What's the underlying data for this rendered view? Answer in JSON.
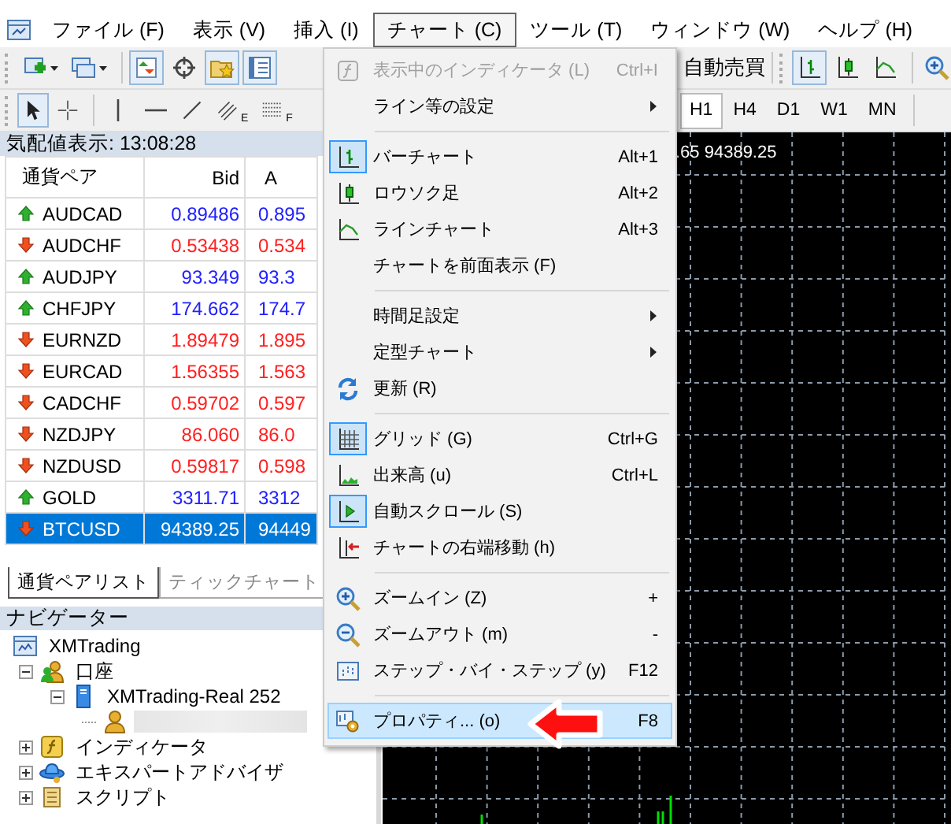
{
  "menu_bar": {
    "items": [
      {
        "label": "ファイル (F)",
        "selected": false
      },
      {
        "label": "表示 (V)",
        "selected": false
      },
      {
        "label": "挿入 (I)",
        "selected": false
      },
      {
        "label": "チャート (C)",
        "selected": true
      },
      {
        "label": "ツール (T)",
        "selected": false
      },
      {
        "label": "ウィンドウ (W)",
        "selected": false
      },
      {
        "label": "ヘルプ (H)",
        "selected": false
      }
    ]
  },
  "standard_toolbar": {
    "left_buttons": [
      {
        "pressed": false
      },
      {
        "pressed": false
      },
      {
        "pressed": true
      },
      {
        "pressed": false
      },
      {
        "pressed": true
      },
      {
        "pressed": true
      }
    ],
    "autotrading_label": "自動売買",
    "chart_buttons": [
      {
        "pressed": true
      },
      {
        "pressed": false
      },
      {
        "pressed": false
      },
      {
        "pressed": false
      }
    ]
  },
  "drawing_toolbar": {
    "tools": [
      {
        "pressed": true
      },
      {
        "pressed": false
      },
      {
        "pressed": false
      },
      {
        "pressed": false
      },
      {
        "pressed": false
      },
      {
        "pressed": false,
        "subscript": "E"
      },
      {
        "pressed": false,
        "subscript": "F"
      }
    ],
    "timeframes": [
      {
        "label": "H1",
        "selected": true
      },
      {
        "label": "H4",
        "selected": false
      },
      {
        "label": "D1",
        "selected": false
      },
      {
        "label": "W1",
        "selected": false
      },
      {
        "label": "MN",
        "selected": false
      }
    ]
  },
  "market_watch": {
    "title": "気配値表示: 13:08:28",
    "columns": [
      "通貨ペア",
      "Bid",
      "A"
    ],
    "rows": [
      {
        "symbol": "AUDCAD",
        "bid": "0.89486",
        "ask": "0.895",
        "rising": true,
        "selected": false
      },
      {
        "symbol": "AUDCHF",
        "bid": "0.53438",
        "ask": "0.534",
        "rising": false,
        "selected": false
      },
      {
        "symbol": "AUDJPY",
        "bid": "93.349",
        "ask": "93.3",
        "rising": true,
        "selected": false
      },
      {
        "symbol": "CHFJPY",
        "bid": "174.662",
        "ask": "174.7",
        "rising": true,
        "selected": false
      },
      {
        "symbol": "EURNZD",
        "bid": "1.89479",
        "ask": "1.895",
        "rising": false,
        "selected": false
      },
      {
        "symbol": "EURCAD",
        "bid": "1.56355",
        "ask": "1.563",
        "rising": false,
        "selected": false
      },
      {
        "symbol": "CADCHF",
        "bid": "0.59702",
        "ask": "0.597",
        "rising": false,
        "selected": false
      },
      {
        "symbol": "NZDJPY",
        "bid": "86.060",
        "ask": "86.0",
        "rising": false,
        "selected": false
      },
      {
        "symbol": "NZDUSD",
        "bid": "0.59817",
        "ask": "0.598",
        "rising": false,
        "selected": false
      },
      {
        "symbol": "GOLD",
        "bid": "3311.71",
        "ask": "3312",
        "rising": true,
        "selected": false
      },
      {
        "symbol": "BTCUSD",
        "bid": "94389.25",
        "ask": "94449",
        "rising": false,
        "selected": true
      }
    ],
    "tabs": [
      {
        "label": "通貨ペアリスト",
        "selected": true
      },
      {
        "label": "ティックチャート",
        "selected": false
      }
    ]
  },
  "navigator": {
    "title": "ナビゲーター",
    "tree": [
      {
        "kind": "broker",
        "label": "XMTrading",
        "children": [
          {
            "kind": "accounts",
            "label": "口座",
            "expanded": true,
            "children": [
              {
                "kind": "server",
                "label": "XMTrading-Real 252",
                "expanded": true,
                "children": [
                  {
                    "kind": "account"
                  }
                ]
              }
            ]
          },
          {
            "kind": "indicators",
            "label": "インディケータ",
            "expanded": false
          },
          {
            "kind": "experts",
            "label": "エキスパートアドバイザ",
            "expanded": false
          },
          {
            "kind": "scripts",
            "label": "スクリプト",
            "expanded": false
          }
        ]
      }
    ]
  },
  "chart": {
    "header": ".65 94389.25"
  },
  "chart_menu": {
    "items": [
      {
        "kind": "command",
        "label": "表示中のインディケータ (L)",
        "shortcut": "Ctrl+I",
        "disabled": true,
        "checked": false,
        "selected": false
      },
      {
        "kind": "submenu",
        "label": "ライン等の設定",
        "disabled": false,
        "checked": false,
        "selected": false
      },
      {
        "kind": "separator"
      },
      {
        "kind": "command",
        "label": "バーチャート",
        "shortcut": "Alt+1",
        "disabled": false,
        "checked": true,
        "selected": false
      },
      {
        "kind": "command",
        "label": "ロウソク足",
        "shortcut": "Alt+2",
        "disabled": false,
        "checked": false,
        "selected": false
      },
      {
        "kind": "command",
        "label": "ラインチャート",
        "shortcut": "Alt+3",
        "disabled": false,
        "checked": false,
        "selected": false
      },
      {
        "kind": "command",
        "label": "チャートを前面表示 (F)",
        "disabled": false,
        "checked": false,
        "selected": false
      },
      {
        "kind": "separator"
      },
      {
        "kind": "submenu",
        "label": "時間足設定",
        "disabled": false,
        "checked": false,
        "selected": false
      },
      {
        "kind": "submenu",
        "label": "定型チャート",
        "disabled": false,
        "checked": false,
        "selected": false
      },
      {
        "kind": "command",
        "label": "更新 (R)",
        "disabled": false,
        "checked": false,
        "selected": false
      },
      {
        "kind": "separator"
      },
      {
        "kind": "command",
        "label": "グリッド (G)",
        "shortcut": "Ctrl+G",
        "disabled": false,
        "checked": true,
        "selected": false
      },
      {
        "kind": "command",
        "label": "出来高 (u)",
        "shortcut": "Ctrl+L",
        "disabled": false,
        "checked": false,
        "selected": false
      },
      {
        "kind": "command",
        "label": "自動スクロール (S)",
        "disabled": false,
        "checked": true,
        "selected": false
      },
      {
        "kind": "command",
        "label": "チャートの右端移動 (h)",
        "disabled": false,
        "checked": false,
        "selected": false
      },
      {
        "kind": "separator"
      },
      {
        "kind": "command",
        "label": "ズームイン (Z)",
        "shortcut": "+",
        "disabled": false,
        "checked": false,
        "selected": false
      },
      {
        "kind": "command",
        "label": "ズームアウト (m)",
        "shortcut": "-",
        "disabled": false,
        "checked": false,
        "selected": false
      },
      {
        "kind": "command",
        "label": "ステップ・バイ・ステップ (y)",
        "shortcut": "F12",
        "disabled": false,
        "checked": false,
        "selected": false
      },
      {
        "kind": "separator"
      },
      {
        "kind": "command",
        "label": "プロパティ... (o)",
        "shortcut": "F8",
        "disabled": false,
        "checked": false,
        "selected": true
      }
    ]
  }
}
